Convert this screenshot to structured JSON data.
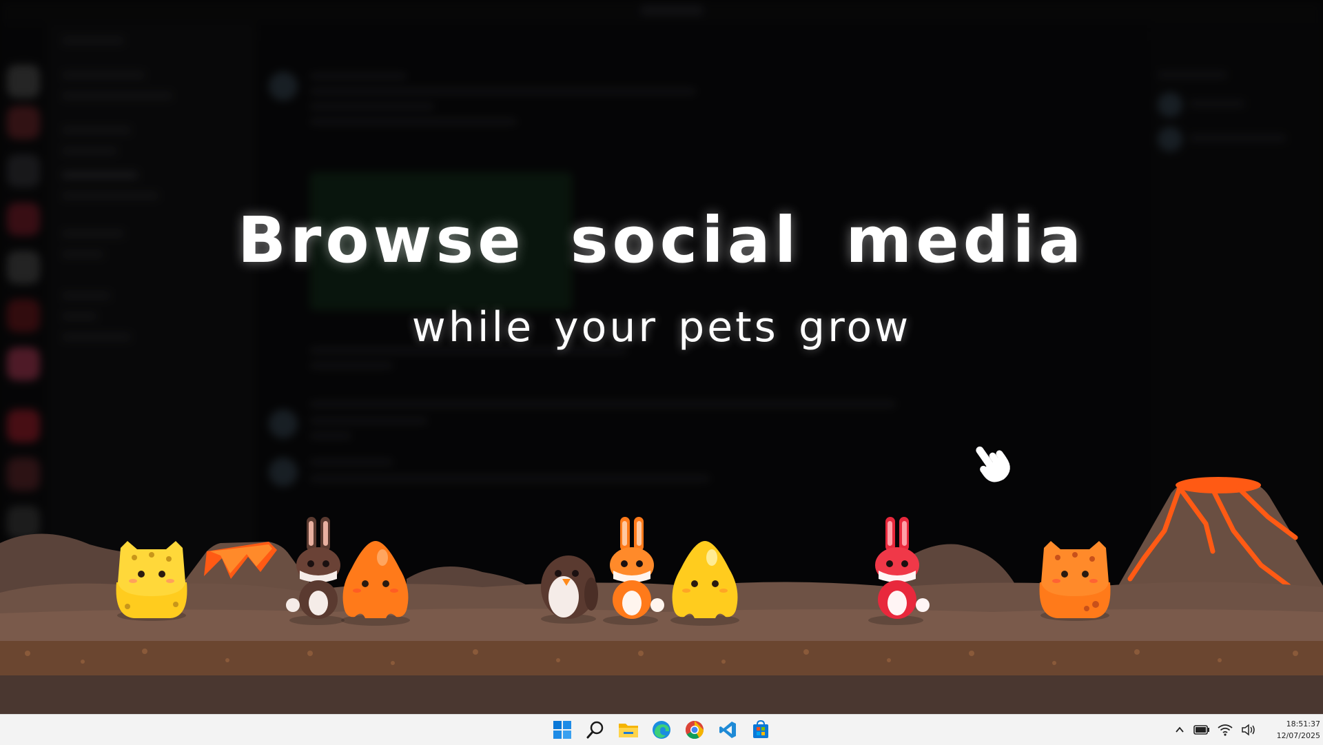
{
  "headline": "Browse social media",
  "subline": "while your pets grow",
  "taskbar": {
    "icons": [
      "windows-start-icon",
      "search-icon",
      "file-explorer-icon",
      "edge-browser-icon",
      "chrome-browser-icon",
      "vscode-icon",
      "microsoft-store-icon"
    ],
    "tray_icons": [
      "chevron-up-icon",
      "battery-icon",
      "wifi-icon",
      "volume-icon"
    ],
    "time": "18:51:37",
    "date": "12/07/2025"
  },
  "colors": {
    "lava": "#ff5a14",
    "rock": "#6a4f42",
    "yellow_pet": "#ffcc1e",
    "orange_pet": "#ff7a1a",
    "red_pet": "#e8283c",
    "brown_pet": "#5a3a30"
  },
  "pets": [
    "yellow-cat",
    "brown-bunny",
    "orange-slime",
    "brown-penguin",
    "orange-bunny",
    "yellow-slime",
    "red-bunny",
    "orange-cat"
  ]
}
